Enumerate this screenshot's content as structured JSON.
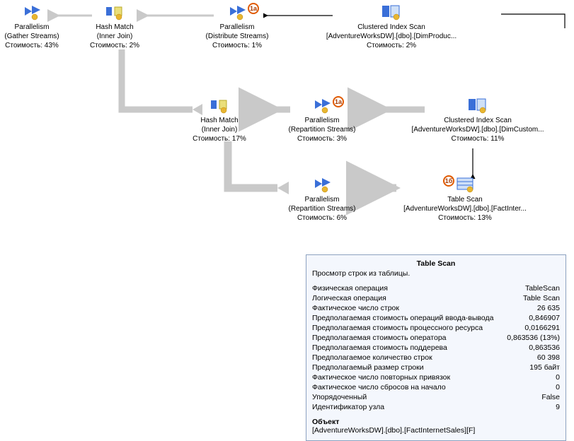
{
  "nodes": {
    "n0": {
      "title": "Parallelism",
      "sub": "(Gather Streams)",
      "cost": "Стоимость: 43%"
    },
    "n1": {
      "title": "Hash Match",
      "sub": "(Inner Join)",
      "cost": "Стоимость: 2%"
    },
    "n2": {
      "title": "Parallelism",
      "sub": "(Distribute Streams)",
      "cost": "Стоимость: 1%"
    },
    "n3": {
      "title": "Clustered Index Scan",
      "sub": "[AdventureWorksDW].[dbo].[DimProduc...",
      "cost": "Стоимость: 2%"
    },
    "n4": {
      "title": "Hash Match",
      "sub": "(Inner Join)",
      "cost": "Стоимость: 17%"
    },
    "n5": {
      "title": "Parallelism",
      "sub": "(Repartition Streams)",
      "cost": "Стоимость: 3%"
    },
    "n6": {
      "title": "Clustered Index Scan",
      "sub": "[AdventureWorksDW].[dbo].[DimCustom...",
      "cost": "Стоимость: 11%"
    },
    "n7": {
      "title": "Parallelism",
      "sub": "(Repartition Streams)",
      "cost": "Стоимость: 6%"
    },
    "n8": {
      "title": "Table Scan",
      "sub": "[AdventureWorksDW].[dbo].[FactInter...",
      "cost": "Стоимость: 13%"
    }
  },
  "badges": {
    "b2": "1a",
    "b5": "1a",
    "b8": "1б"
  },
  "tooltip": {
    "title": "Table Scan",
    "desc": "Просмотр строк из таблицы.",
    "rows": [
      {
        "k": "Физическая операция",
        "v": "TableScan"
      },
      {
        "k": "Логическая операция",
        "v": "Table Scan"
      },
      {
        "k": "Фактическое число строк",
        "v": "26 635"
      },
      {
        "k": "Предполагаемая стоимость операций ввода-вывода",
        "v": "0,846907"
      },
      {
        "k": "Предполагаемая стоимость процессного ресурса",
        "v": "0,0166291"
      },
      {
        "k": "Предполагаемая стоимость оператора",
        "v": "0,863536 (13%)"
      },
      {
        "k": "Предполагаемая стоимость поддерева",
        "v": "0,863536"
      },
      {
        "k": "Предполагаемое количество строк",
        "v": "60 398"
      },
      {
        "k": "Предполагаемый размер строки",
        "v": "195 байт"
      },
      {
        "k": "Фактическое число повторных привязок",
        "v": "0"
      },
      {
        "k": "Фактическое число сбросов на начало",
        "v": "0"
      },
      {
        "k": "Упорядоченный",
        "v": "False"
      },
      {
        "k": "Идентификатор узла",
        "v": "9"
      }
    ],
    "object_h": "Объект",
    "object_v": "[AdventureWorksDW].[dbo].[FactInternetSales][F]"
  }
}
